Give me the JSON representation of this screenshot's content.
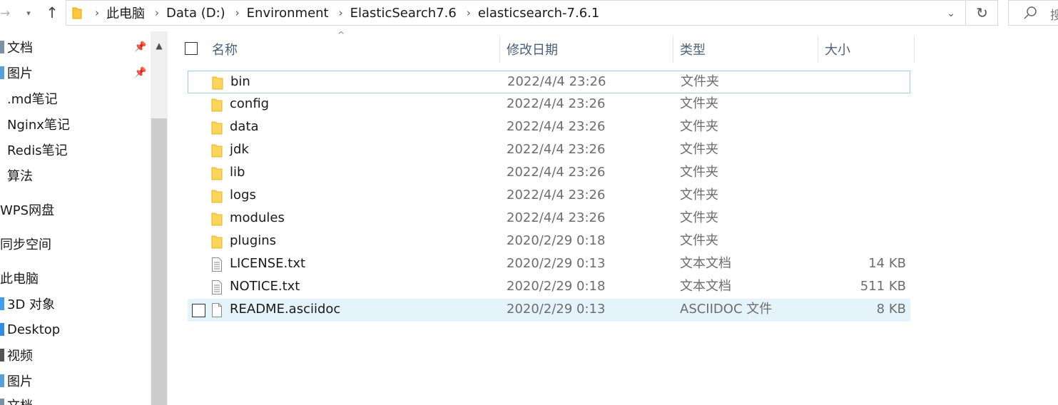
{
  "address_bar": {
    "crumbs": [
      "此电脑",
      "Data (D:)",
      "Environment",
      "ElasticSearch7.6",
      "elasticsearch-7.6.1"
    ],
    "search_placeholder": "搜"
  },
  "sidebar": {
    "items": [
      {
        "label": "文档",
        "pinned": true
      },
      {
        "label": "图片",
        "pinned": true
      },
      {
        "label": ".md笔记"
      },
      {
        "label": "Nginx笔记"
      },
      {
        "label": "Redis笔记"
      },
      {
        "label": "算法"
      },
      {
        "label": "WPS网盘"
      },
      {
        "label": "同步空间"
      },
      {
        "label": "此电脑"
      },
      {
        "label": "3D 对象"
      },
      {
        "label": "Desktop"
      },
      {
        "label": "视频"
      },
      {
        "label": "图片"
      },
      {
        "label": "文档"
      }
    ]
  },
  "columns": {
    "name": "名称",
    "modified": "修改日期",
    "type": "类型",
    "size": "大小"
  },
  "files": [
    {
      "name": "bin",
      "modified": "2022/4/4 23:26",
      "type": "文件夹",
      "size": "",
      "icon": "folder-icon"
    },
    {
      "name": "config",
      "modified": "2022/4/4 23:26",
      "type": "文件夹",
      "size": "",
      "icon": "folder-icon"
    },
    {
      "name": "data",
      "modified": "2022/4/4 23:26",
      "type": "文件夹",
      "size": "",
      "icon": "folder-icon"
    },
    {
      "name": "jdk",
      "modified": "2022/4/4 23:26",
      "type": "文件夹",
      "size": "",
      "icon": "folder-icon"
    },
    {
      "name": "lib",
      "modified": "2022/4/4 23:26",
      "type": "文件夹",
      "size": "",
      "icon": "folder-icon"
    },
    {
      "name": "logs",
      "modified": "2022/4/4 23:26",
      "type": "文件夹",
      "size": "",
      "icon": "folder-icon"
    },
    {
      "name": "modules",
      "modified": "2022/4/4 23:26",
      "type": "文件夹",
      "size": "",
      "icon": "folder-icon"
    },
    {
      "name": "plugins",
      "modified": "2020/2/29 0:18",
      "type": "文件夹",
      "size": "",
      "icon": "folder-icon"
    },
    {
      "name": "LICENSE.txt",
      "modified": "2020/2/29 0:13",
      "type": "文本文档",
      "size": "14 KB",
      "icon": "text-file-icon"
    },
    {
      "name": "NOTICE.txt",
      "modified": "2020/2/29 0:18",
      "type": "文本文档",
      "size": "511 KB",
      "icon": "text-file-icon"
    },
    {
      "name": "README.asciidoc",
      "modified": "2020/2/29 0:13",
      "type": "ASCIIDOC 文件",
      "size": "8 KB",
      "icon": "blank-file-icon"
    }
  ],
  "colors": {
    "accent": "#0078d7",
    "folder": "#ffd55b",
    "hover_row": "#e5f3fb",
    "focus_border": "#99d1e0",
    "header_text": "#4c607a"
  }
}
